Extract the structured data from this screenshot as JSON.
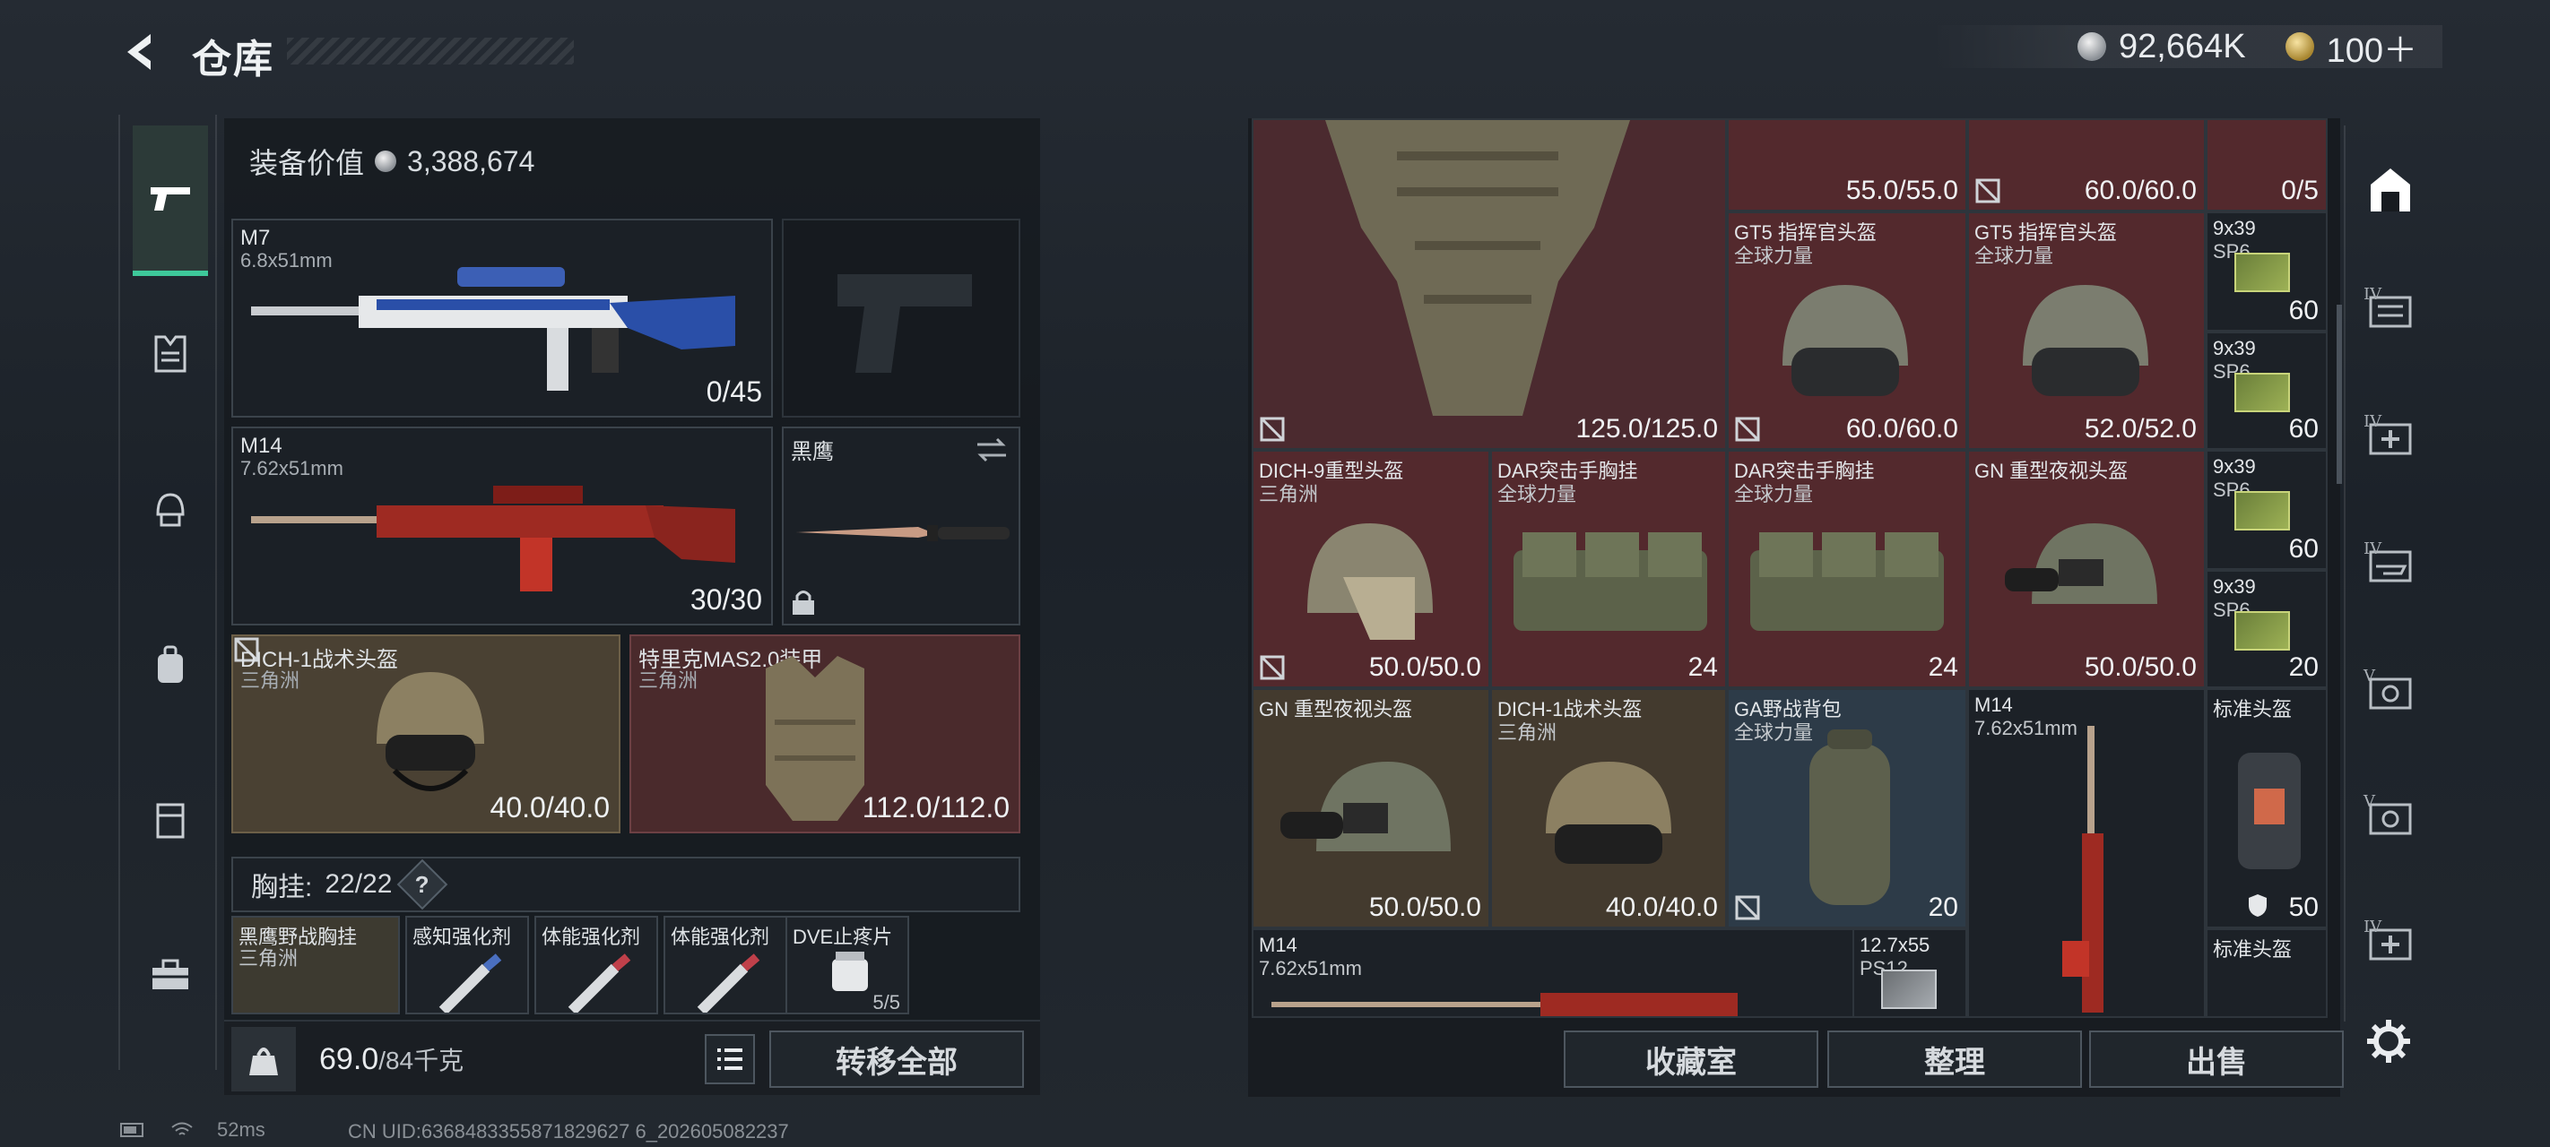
{
  "header": {
    "title": "仓库",
    "currency_silver": "92,664K",
    "currency_gold": "100＋"
  },
  "left_rail": [
    "pistol-icon",
    "vest-icon",
    "helmet-icon",
    "backpack-icon",
    "case-icon",
    "toolbox-icon"
  ],
  "equip": {
    "value_label": "装备价值",
    "value": "3,388,674",
    "slots": {
      "m7": {
        "name": "M7",
        "caliber": "6.8x51mm",
        "ammo": "0/45"
      },
      "m14": {
        "name": "M14",
        "caliber": "7.62x51mm",
        "ammo": "30/30"
      },
      "knife": {
        "name": "黑鹰"
      },
      "helmet": {
        "name": "DICH-1战术头盔",
        "faction": "三角洲",
        "durability": "40.0/40.0"
      },
      "armor": {
        "name": "特里克MAS2.0装甲",
        "faction": "三角洲",
        "durability": "112.0/112.0"
      }
    },
    "rig_label": "胸挂:",
    "rig_capacity": "22/22",
    "rig_help": "?",
    "rig_items": [
      {
        "name": "黑鹰野战胸挂",
        "sub": "三角洲"
      },
      {
        "name": "感知强化剂",
        "sub": ""
      },
      {
        "name": "体能强化剂",
        "sub": ""
      },
      {
        "name": "体能强化剂",
        "sub": ""
      },
      {
        "name": "DVE止疼片",
        "sub": "5/5"
      }
    ],
    "weight": "69.0",
    "weight_max": "/84千克",
    "transfer_all": "转移全部"
  },
  "storage": {
    "cells": [
      {
        "id": "armor-big",
        "name": "",
        "sub": "",
        "val": "125.0/125.0"
      },
      {
        "id": "top1",
        "name": "",
        "sub": "",
        "val": "55.0/55.0"
      },
      {
        "id": "top2",
        "name": "",
        "sub": "",
        "val": "60.0/60.0"
      },
      {
        "id": "top3",
        "name": "",
        "sub": "",
        "val": "0/5"
      },
      {
        "id": "gt5a",
        "name": "GT5 指挥官头盔",
        "sub": "全球力量",
        "val": "60.0/60.0"
      },
      {
        "id": "gt5b",
        "name": "GT5 指挥官头盔",
        "sub": "全球力量",
        "val": "52.0/52.0"
      },
      {
        "id": "ammo1",
        "name": "9x39",
        "sub": "SP6",
        "val": "60"
      },
      {
        "id": "ammo2",
        "name": "9x39",
        "sub": "SP6",
        "val": "60"
      },
      {
        "id": "dich9",
        "name": "DICH-9重型头盔",
        "sub": "三角洲",
        "val": "50.0/50.0"
      },
      {
        "id": "dar1",
        "name": "DAR突击手胸挂",
        "sub": "全球力量",
        "val": "24"
      },
      {
        "id": "dar2",
        "name": "DAR突击手胸挂",
        "sub": "全球力量",
        "val": "24"
      },
      {
        "id": "gnnv1",
        "name": "GN 重型夜视头盔",
        "sub": "",
        "val": "50.0/50.0"
      },
      {
        "id": "ammo3",
        "name": "9x39",
        "sub": "SP6",
        "val": "60"
      },
      {
        "id": "ammo4",
        "name": "9x39",
        "sub": "SP6",
        "val": "20"
      },
      {
        "id": "gnnv2",
        "name": "GN 重型夜视头盔",
        "sub": "",
        "val": "50.0/50.0"
      },
      {
        "id": "dich1",
        "name": "DICH-1战术头盔",
        "sub": "三角洲",
        "val": "40.0/40.0"
      },
      {
        "id": "ga",
        "name": "GA野战背包",
        "sub": "全球力量",
        "val": "20"
      },
      {
        "id": "m14v",
        "name": "M14",
        "sub": "7.62x51mm",
        "val": ""
      },
      {
        "id": "std1",
        "name": "标准头盔",
        "sub": "",
        "val": "50"
      },
      {
        "id": "m14h",
        "name": "M14",
        "sub": "7.62x51mm",
        "val": ""
      },
      {
        "id": "ammo5",
        "name": "12.7x55",
        "sub": "PS12",
        "val": ""
      },
      {
        "id": "std2",
        "name": "标准头盔",
        "sub": "",
        "val": ""
      }
    ]
  },
  "right_rail": [
    {
      "icon": "storage-icon",
      "tier": ""
    },
    {
      "icon": "expansion-icon",
      "tier": "IV"
    },
    {
      "icon": "medical-expansion-icon",
      "tier": "IV"
    },
    {
      "icon": "weapon-expansion-icon",
      "tier": "IV"
    },
    {
      "icon": "camera-expansion-icon",
      "tier": "V"
    },
    {
      "icon": "camera-expansion-icon",
      "tier": "V"
    },
    {
      "icon": "medical-expansion-icon",
      "tier": "IV"
    }
  ],
  "bottom": {
    "btn_collection": "收藏室",
    "btn_sort": "整理",
    "btn_sell": "出售"
  },
  "status": {
    "ping": "52ms",
    "uid": "CN UID:6368483355871829627 6_202605082237"
  },
  "colors": {
    "accent_green": "#3ec89a",
    "tan": "#433a2e",
    "red": "#4b2a2f",
    "blue": "#2d3b48"
  }
}
